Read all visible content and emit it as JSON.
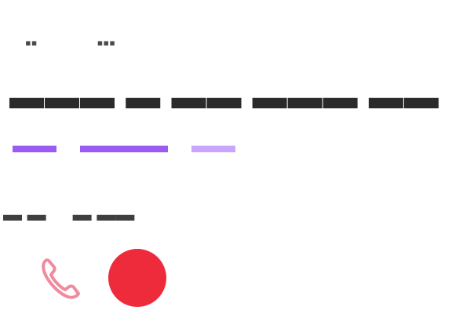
{
  "colors": {
    "text": "#2a2a2a",
    "link": "#9b5cf4",
    "link_faint": "#c9a6fb",
    "record": "#ee2b3b",
    "phone_icon": "#f08a9c"
  },
  "icons": {
    "call": "phone-icon",
    "record": "record-icon"
  }
}
